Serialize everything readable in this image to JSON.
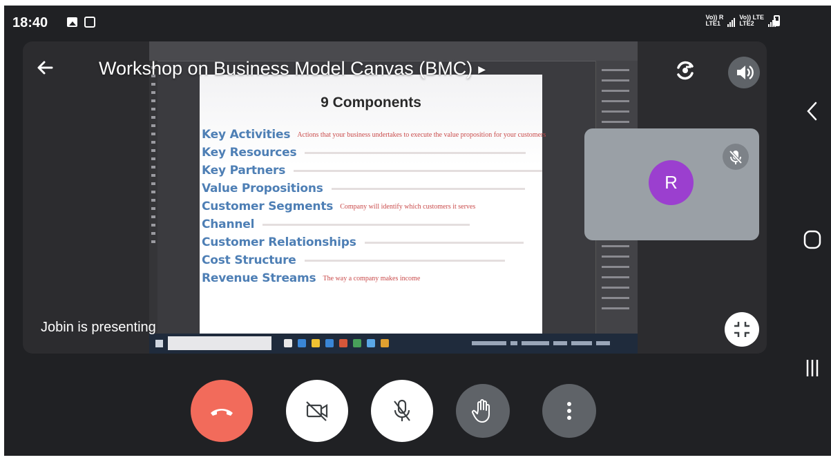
{
  "status_bar": {
    "time": "18:40",
    "sim1_label": "Vo)) R",
    "sim1_sub": "LTE1",
    "sim2_label": "Vo)) LTE",
    "sim2_sub": "LTE2"
  },
  "meeting": {
    "title": "Workshop on Business Model Canvas (BMC)",
    "presenter_label": "Jobin is presenting"
  },
  "slide": {
    "title": "9 Components",
    "components": [
      {
        "name": "Key Activities",
        "desc": "Actions that your business undertakes to execute the value proposition for your customers"
      },
      {
        "name": "Key Resources",
        "desc": ""
      },
      {
        "name": "Key Partners",
        "desc": ""
      },
      {
        "name": "Value Propositions",
        "desc": ""
      },
      {
        "name": "Customer Segments",
        "desc": "Company will identify which customers it serves"
      },
      {
        "name": "Channel",
        "desc": ""
      },
      {
        "name": "Customer Relationships",
        "desc": ""
      },
      {
        "name": "Cost Structure",
        "desc": ""
      },
      {
        "name": "Revenue Streams",
        "desc": "The way a company makes income"
      }
    ]
  },
  "participant": {
    "initial": "R",
    "avatar_color": "#9b3fcf"
  },
  "controls": {
    "end_call_color": "#f26b5b",
    "icons": [
      "phone-hangup-icon",
      "camera-off-icon",
      "mic-off-icon",
      "raise-hand-icon",
      "more-vert-icon"
    ]
  },
  "colors": {
    "background": "#202124",
    "slide_heading": "#4e7fb5",
    "slide_desc": "#c94a4a"
  }
}
